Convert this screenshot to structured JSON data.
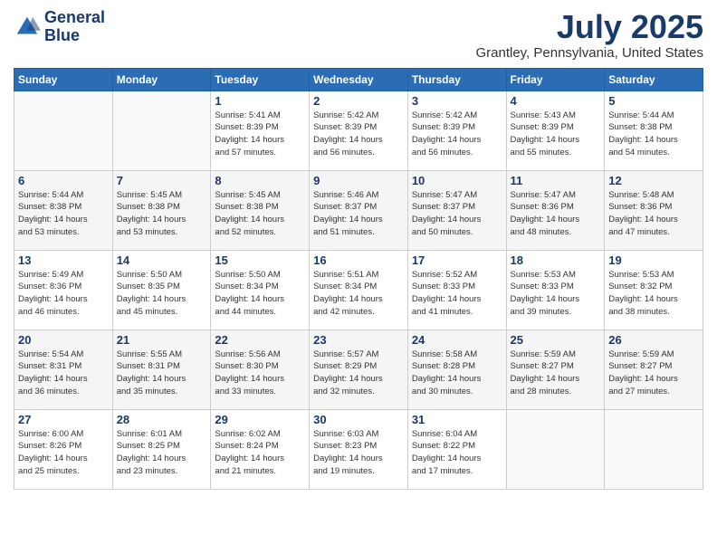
{
  "header": {
    "logo_line1": "General",
    "logo_line2": "Blue",
    "title": "July 2025",
    "location": "Grantley, Pennsylvania, United States"
  },
  "weekdays": [
    "Sunday",
    "Monday",
    "Tuesday",
    "Wednesday",
    "Thursday",
    "Friday",
    "Saturday"
  ],
  "weeks": [
    [
      {
        "day": "",
        "info": ""
      },
      {
        "day": "",
        "info": ""
      },
      {
        "day": "1",
        "info": "Sunrise: 5:41 AM\nSunset: 8:39 PM\nDaylight: 14 hours\nand 57 minutes."
      },
      {
        "day": "2",
        "info": "Sunrise: 5:42 AM\nSunset: 8:39 PM\nDaylight: 14 hours\nand 56 minutes."
      },
      {
        "day": "3",
        "info": "Sunrise: 5:42 AM\nSunset: 8:39 PM\nDaylight: 14 hours\nand 56 minutes."
      },
      {
        "day": "4",
        "info": "Sunrise: 5:43 AM\nSunset: 8:39 PM\nDaylight: 14 hours\nand 55 minutes."
      },
      {
        "day": "5",
        "info": "Sunrise: 5:44 AM\nSunset: 8:38 PM\nDaylight: 14 hours\nand 54 minutes."
      }
    ],
    [
      {
        "day": "6",
        "info": "Sunrise: 5:44 AM\nSunset: 8:38 PM\nDaylight: 14 hours\nand 53 minutes."
      },
      {
        "day": "7",
        "info": "Sunrise: 5:45 AM\nSunset: 8:38 PM\nDaylight: 14 hours\nand 53 minutes."
      },
      {
        "day": "8",
        "info": "Sunrise: 5:45 AM\nSunset: 8:38 PM\nDaylight: 14 hours\nand 52 minutes."
      },
      {
        "day": "9",
        "info": "Sunrise: 5:46 AM\nSunset: 8:37 PM\nDaylight: 14 hours\nand 51 minutes."
      },
      {
        "day": "10",
        "info": "Sunrise: 5:47 AM\nSunset: 8:37 PM\nDaylight: 14 hours\nand 50 minutes."
      },
      {
        "day": "11",
        "info": "Sunrise: 5:47 AM\nSunset: 8:36 PM\nDaylight: 14 hours\nand 48 minutes."
      },
      {
        "day": "12",
        "info": "Sunrise: 5:48 AM\nSunset: 8:36 PM\nDaylight: 14 hours\nand 47 minutes."
      }
    ],
    [
      {
        "day": "13",
        "info": "Sunrise: 5:49 AM\nSunset: 8:36 PM\nDaylight: 14 hours\nand 46 minutes."
      },
      {
        "day": "14",
        "info": "Sunrise: 5:50 AM\nSunset: 8:35 PM\nDaylight: 14 hours\nand 45 minutes."
      },
      {
        "day": "15",
        "info": "Sunrise: 5:50 AM\nSunset: 8:34 PM\nDaylight: 14 hours\nand 44 minutes."
      },
      {
        "day": "16",
        "info": "Sunrise: 5:51 AM\nSunset: 8:34 PM\nDaylight: 14 hours\nand 42 minutes."
      },
      {
        "day": "17",
        "info": "Sunrise: 5:52 AM\nSunset: 8:33 PM\nDaylight: 14 hours\nand 41 minutes."
      },
      {
        "day": "18",
        "info": "Sunrise: 5:53 AM\nSunset: 8:33 PM\nDaylight: 14 hours\nand 39 minutes."
      },
      {
        "day": "19",
        "info": "Sunrise: 5:53 AM\nSunset: 8:32 PM\nDaylight: 14 hours\nand 38 minutes."
      }
    ],
    [
      {
        "day": "20",
        "info": "Sunrise: 5:54 AM\nSunset: 8:31 PM\nDaylight: 14 hours\nand 36 minutes."
      },
      {
        "day": "21",
        "info": "Sunrise: 5:55 AM\nSunset: 8:31 PM\nDaylight: 14 hours\nand 35 minutes."
      },
      {
        "day": "22",
        "info": "Sunrise: 5:56 AM\nSunset: 8:30 PM\nDaylight: 14 hours\nand 33 minutes."
      },
      {
        "day": "23",
        "info": "Sunrise: 5:57 AM\nSunset: 8:29 PM\nDaylight: 14 hours\nand 32 minutes."
      },
      {
        "day": "24",
        "info": "Sunrise: 5:58 AM\nSunset: 8:28 PM\nDaylight: 14 hours\nand 30 minutes."
      },
      {
        "day": "25",
        "info": "Sunrise: 5:59 AM\nSunset: 8:27 PM\nDaylight: 14 hours\nand 28 minutes."
      },
      {
        "day": "26",
        "info": "Sunrise: 5:59 AM\nSunset: 8:27 PM\nDaylight: 14 hours\nand 27 minutes."
      }
    ],
    [
      {
        "day": "27",
        "info": "Sunrise: 6:00 AM\nSunset: 8:26 PM\nDaylight: 14 hours\nand 25 minutes."
      },
      {
        "day": "28",
        "info": "Sunrise: 6:01 AM\nSunset: 8:25 PM\nDaylight: 14 hours\nand 23 minutes."
      },
      {
        "day": "29",
        "info": "Sunrise: 6:02 AM\nSunset: 8:24 PM\nDaylight: 14 hours\nand 21 minutes."
      },
      {
        "day": "30",
        "info": "Sunrise: 6:03 AM\nSunset: 8:23 PM\nDaylight: 14 hours\nand 19 minutes."
      },
      {
        "day": "31",
        "info": "Sunrise: 6:04 AM\nSunset: 8:22 PM\nDaylight: 14 hours\nand 17 minutes."
      },
      {
        "day": "",
        "info": ""
      },
      {
        "day": "",
        "info": ""
      }
    ]
  ]
}
